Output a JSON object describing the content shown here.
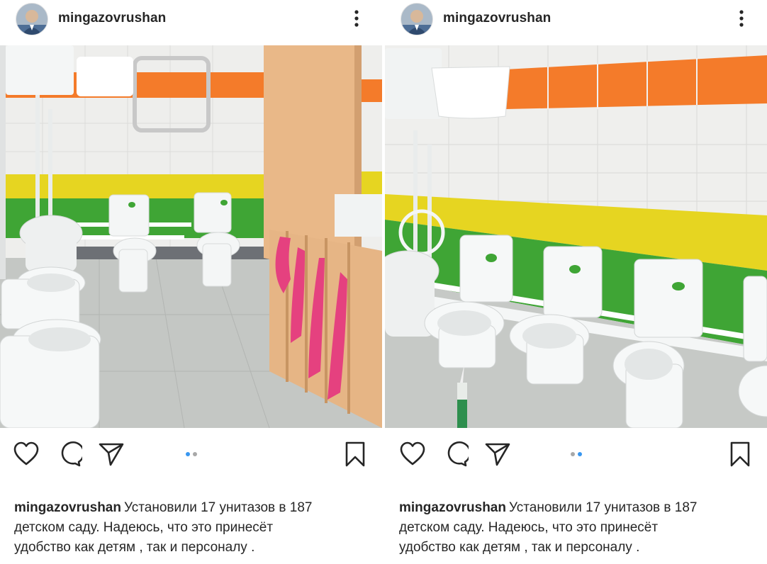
{
  "posts": [
    {
      "username": "mingazovrushan",
      "caption_line1": "Установили 17 унитазов в 187",
      "caption_line2": "детском саду. Надеюсь, что это принесёт",
      "caption_line3": "удобство как детям , так и персоналу .",
      "carousel_index": 1,
      "carousel_total": 2
    },
    {
      "username": "mingazovrushan",
      "caption_line1": "Установили 17 унитазов в 187",
      "caption_line2": "детском саду. Надеюсь, что это принесёт",
      "caption_line3": "удобство как детям , так и персоналу .",
      "carousel_index": 2,
      "carousel_total": 2
    }
  ],
  "icons": [
    "avatar",
    "more-icon",
    "heart-icon",
    "comment-icon",
    "share-icon",
    "bookmark-icon"
  ],
  "colors": {
    "accent_dot": "#3897f0",
    "inactive_dot": "#a8a8a8",
    "tile_orange": "#f47b2a",
    "tile_yellow": "#e6d521",
    "tile_green": "#3fa535",
    "floor": "#c4c7c4",
    "toilet": "#f4f6f6"
  }
}
